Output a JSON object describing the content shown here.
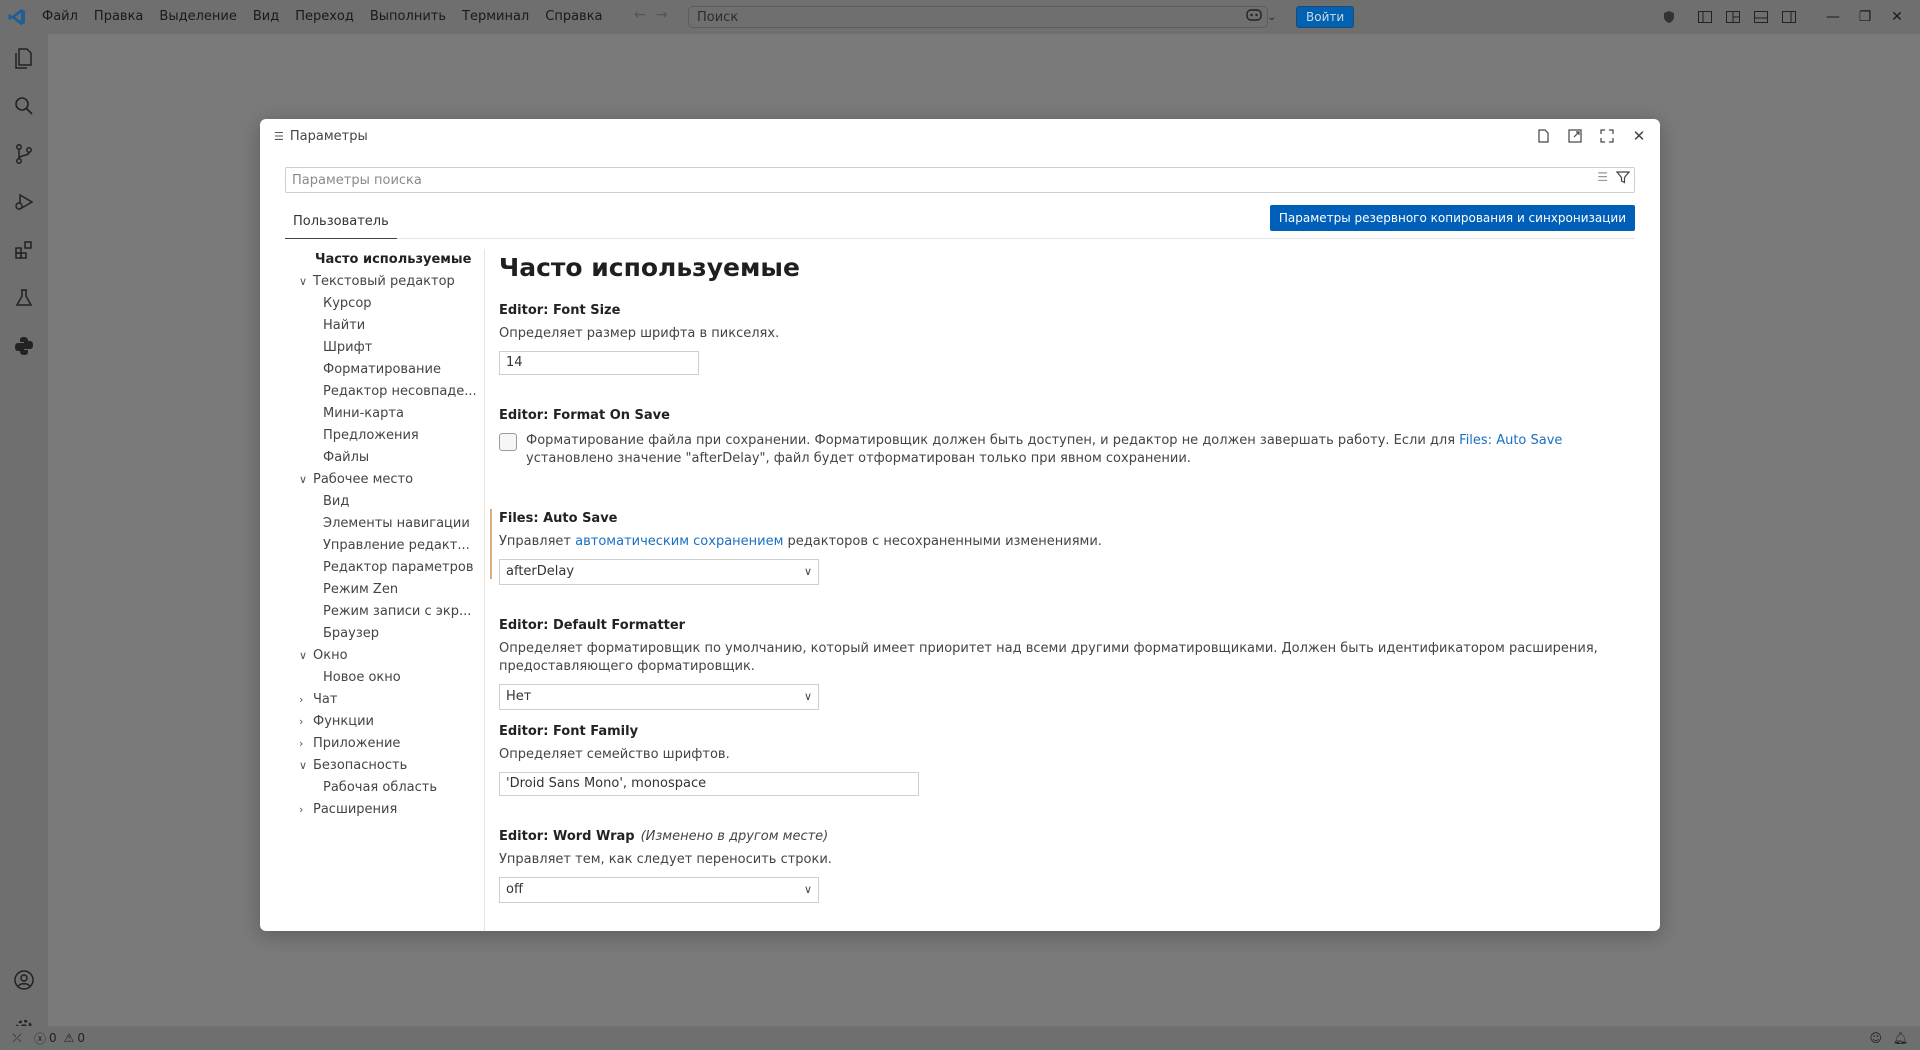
{
  "menu": [
    "Файл",
    "Правка",
    "Выделение",
    "Вид",
    "Переход",
    "Выполнить",
    "Терминал",
    "Справка"
  ],
  "command_center": {
    "placeholder": "Поиск"
  },
  "signin_label": "Войти",
  "modal": {
    "title": "Параметры",
    "search_placeholder": "Параметры поиска",
    "tab_user": "Пользователь",
    "backup_button": "Параметры резервного копирования и синхронизации"
  },
  "toc": [
    {
      "label": "Часто используемые",
      "level": 0,
      "bold": true,
      "chevron": ""
    },
    {
      "label": "Текстовый редактор",
      "level": 0,
      "chevron": "open"
    },
    {
      "label": "Курсор",
      "level": 1
    },
    {
      "label": "Найти",
      "level": 1
    },
    {
      "label": "Шрифт",
      "level": 1
    },
    {
      "label": "Форматирование",
      "level": 1
    },
    {
      "label": "Редактор несовпаде...",
      "level": 1
    },
    {
      "label": "Мини-карта",
      "level": 1
    },
    {
      "label": "Предложения",
      "level": 1
    },
    {
      "label": "Файлы",
      "level": 1
    },
    {
      "label": "Рабочее место",
      "level": 0,
      "chevron": "open"
    },
    {
      "label": "Вид",
      "level": 1
    },
    {
      "label": "Элементы навигации",
      "level": 1
    },
    {
      "label": "Управление редакт...",
      "level": 1
    },
    {
      "label": "Редактор параметров",
      "level": 1
    },
    {
      "label": "Режим Zen",
      "level": 1
    },
    {
      "label": "Режим записи с экр...",
      "level": 1
    },
    {
      "label": "Браузер",
      "level": 1
    },
    {
      "label": "Окно",
      "level": 0,
      "chevron": "open"
    },
    {
      "label": "Новое окно",
      "level": 1
    },
    {
      "label": "Чат",
      "level": 0,
      "chevron": "closed"
    },
    {
      "label": "Функции",
      "level": 0,
      "chevron": "closed"
    },
    {
      "label": "Приложение",
      "level": 0,
      "chevron": "closed"
    },
    {
      "label": "Безопасность",
      "level": 0,
      "chevron": "open"
    },
    {
      "label": "Рабочая область",
      "level": 1
    },
    {
      "label": "Расширения",
      "level": 0,
      "chevron": "closed"
    }
  ],
  "page_title": "Часто используемые",
  "settings": {
    "font_size": {
      "category": "Editor: ",
      "name": "Font Size",
      "desc": "Определяет размер шрифта в пикселях.",
      "value": "14"
    },
    "format_on_save": {
      "category": "Editor: ",
      "name": "Format On Save",
      "desc_before": "Форматирование файла при сохранении. Форматировщик должен быть доступен, и редактор не должен завершать работу. Если для ",
      "desc_link": "Files: Auto Save",
      "desc_after": " установлено значение \"afterDelay\", файл будет отформатирован только при явном сохранении.",
      "checked": false
    },
    "auto_save": {
      "category": "Files: ",
      "name": "Auto Save",
      "desc_before": "Управляет ",
      "desc_link": "автоматическим сохранением",
      "desc_after": " редакторов с несохраненными изменениями.",
      "value": "afterDelay"
    },
    "default_formatter": {
      "category": "Editor: ",
      "name": "Default Formatter",
      "desc": "Определяет форматировщик по умолчанию, который имеет приоритет над всеми другими форматировщиками. Должен быть идентификатором расширения, предоставляющего форматировщик.",
      "value": "Нет"
    },
    "font_family": {
      "category": "Editor: ",
      "name": "Font Family",
      "desc": "Определяет семейство шрифтов.",
      "value": "'Droid Sans Mono', monospace"
    },
    "word_wrap": {
      "category": "Editor: ",
      "name": "Word Wrap",
      "modified_note": "(Изменено в другом месте)",
      "desc": "Управляет тем, как следует переносить строки.",
      "value": "off"
    }
  },
  "status": {
    "errors": "0",
    "warnings": "0"
  },
  "colors": {
    "accent": "#005fb8",
    "link": "#1a6fc2",
    "modified": "#e0a97c"
  }
}
